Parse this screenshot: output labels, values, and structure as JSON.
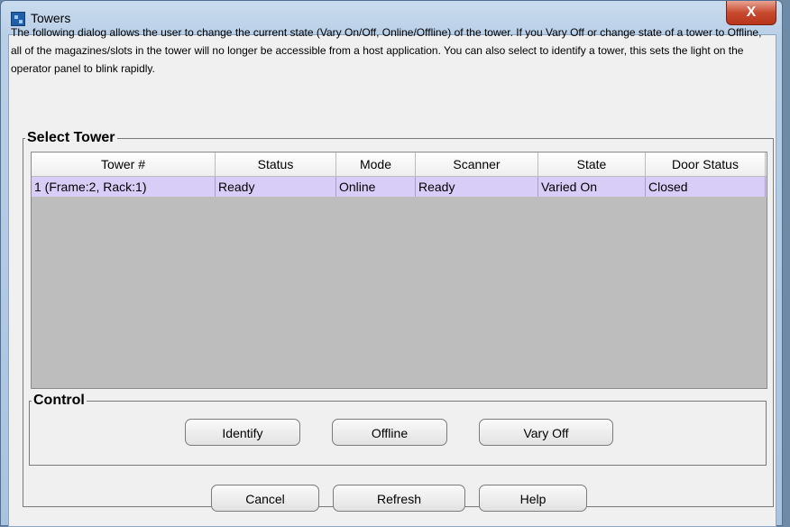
{
  "window": {
    "title": "Towers",
    "close_symbol": "X",
    "background_title_text_left": "...",
    "background_title_text_right": "..."
  },
  "description": "The following dialog allows the user to change the current state (Vary On/Off, Online/Offline) of the tower. If you Vary Off or change state of a tower to Offline, all of the magazines/slots in the tower will no longer be accessible from a host application. You can also select to identify a tower, this sets the light on the operator panel to blink rapidly.",
  "select_tower": {
    "legend": "Select Tower",
    "columns": [
      "Tower #",
      "Status",
      "Mode",
      "Scanner",
      "State",
      "Door Status"
    ],
    "rows": [
      [
        "1 (Frame:2, Rack:1)",
        "Ready",
        "Online",
        "Ready",
        "Varied On",
        "Closed"
      ]
    ]
  },
  "control": {
    "legend": "Control",
    "identify_label": "Identify",
    "offline_label": "Offline",
    "vary_off_label": "Vary Off"
  },
  "footer": {
    "cancel_label": "Cancel",
    "refresh_label": "Refresh",
    "help_label": "Help"
  },
  "colors": {
    "selected_row": "#d7cdf7",
    "table_background": "#bdbdbd",
    "close_button": "#c74a2f"
  },
  "icons": [
    "app-window-icon",
    "close-icon"
  ]
}
